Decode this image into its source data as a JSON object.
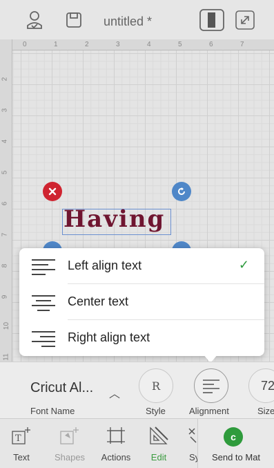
{
  "header": {
    "title": "untitled *",
    "icons": [
      "account-icon",
      "save-icon",
      "mat-view-icon",
      "fullscreen-icon"
    ]
  },
  "canvas": {
    "ruler_top": [
      "0",
      "1",
      "2",
      "3",
      "4",
      "5",
      "6",
      "7"
    ],
    "ruler_left": [
      "2",
      "3",
      "4",
      "5",
      "6",
      "7",
      "8",
      "9",
      "10",
      "11"
    ],
    "text_object": "Having"
  },
  "alignment_menu": {
    "options": [
      {
        "label": "Left align text",
        "selected": true
      },
      {
        "label": "Center text",
        "selected": false
      },
      {
        "label": "Right align text",
        "selected": false
      }
    ],
    "check_mark": "✓"
  },
  "text_panel": {
    "font_name_value": "Cricut Al...",
    "font_name_label": "Font Name",
    "style_value": "R",
    "style_label": "Style",
    "alignment_label": "Alignment",
    "size_value": "72",
    "size_label": "Size"
  },
  "tabbar": {
    "text": "Text",
    "shapes": "Shapes",
    "actions": "Actions",
    "edit": "Edit",
    "sync": "Sy",
    "send": "Send to Mat"
  },
  "colors": {
    "accent_green": "#2f9b3c",
    "handle_blue": "#4f87c8",
    "delete_red": "#cf2430",
    "text_maroon": "#6f1530"
  }
}
